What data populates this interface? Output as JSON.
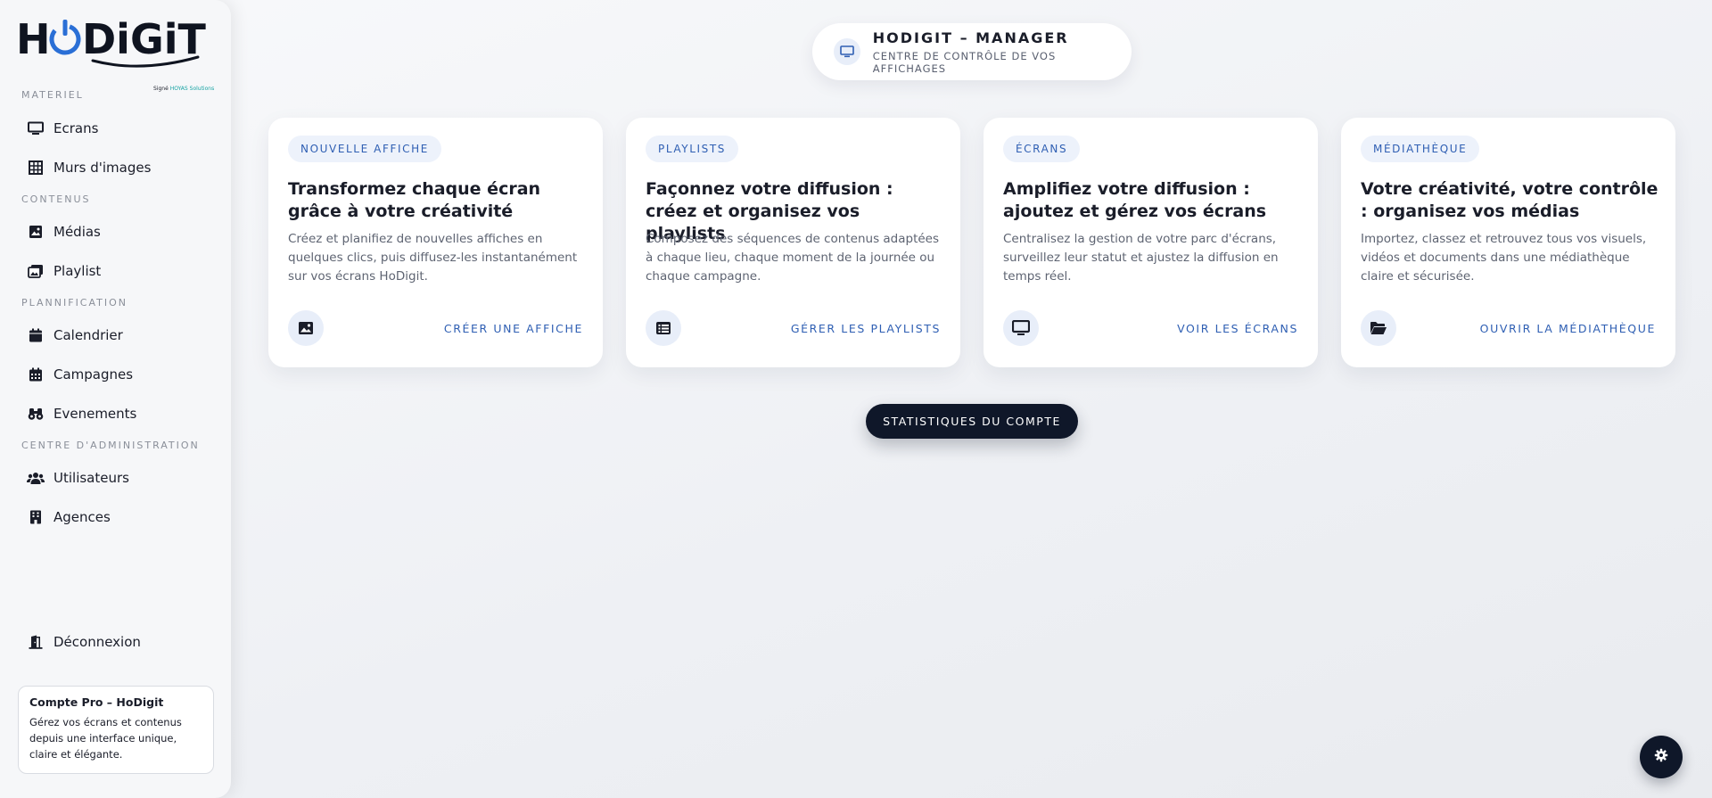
{
  "sidebar": {
    "logo_text": "HoDiGiT",
    "logo_tagline_prefix": "Signé",
    "logo_tagline_brand": "HOYAS Solutions",
    "sections": {
      "materiel": "MATERIEL",
      "contenus": "CONTENUS",
      "planification": "PLANNIFICATION",
      "administration": "CENTRE D'ADMINISTRATION"
    },
    "items": {
      "ecrans": "Ecrans",
      "murs": "Murs d'images",
      "medias": "Médias",
      "playlist": "Playlist",
      "calendrier": "Calendrier",
      "campagnes": "Campagnes",
      "evenements": "Evenements",
      "utilisateurs": "Utilisateurs",
      "agences": "Agences",
      "deconnexion": "Déconnexion"
    },
    "promo": {
      "title": "Compte Pro – HoDigit",
      "text": "Gérez vos écrans et contenus depuis une interface unique, claire et élégante."
    }
  },
  "header": {
    "title": "HODIGIT – MANAGER",
    "subtitle": "CENTRE DE CONTRÔLE DE VOS AFFICHAGES"
  },
  "cards": [
    {
      "badge": "NOUVELLE AFFICHE",
      "title": "Transformez chaque écran grâce à votre créativité",
      "desc": "Créez et planifiez de nouvelles affiches en quelques clics, puis diffusez-les instantanément sur vos écrans HoDigit.",
      "icon": "image-icon",
      "link": "CRÉER UNE AFFICHE"
    },
    {
      "badge": "PLAYLISTS",
      "title": "Façonnez votre diffusion : créez et organisez vos playlists",
      "desc": "Composez des séquences de contenus adaptées à chaque lieu, chaque moment de la journée ou chaque campagne.",
      "icon": "list-icon",
      "link": "GÉRER LES PLAYLISTS"
    },
    {
      "badge": "ÉCRANS",
      "title": "Amplifiez votre diffusion : ajoutez et gérez vos écrans",
      "desc": "Centralisez la gestion de votre parc d'écrans, surveillez leur statut et ajustez la diffusion en temps réel.",
      "icon": "monitor-icon",
      "link": "VOIR LES ÉCRANS"
    },
    {
      "badge": "MÉDIATHÈQUE",
      "title": "Votre créativité, votre contrôle : organisez vos médias",
      "desc": "Importez, classez et retrouvez tous vos visuels, vidéos et documents dans une médiathèque claire et sécurisée.",
      "icon": "folder-open-icon",
      "link": "OUVRIR LA MÉDIATHÈQUE"
    }
  ],
  "stats_button": "STATISTIQUES DU COMPTE",
  "colors": {
    "accent": "#2f5fb3",
    "dark": "#0f1729",
    "badge_bg": "#edf2fb"
  }
}
